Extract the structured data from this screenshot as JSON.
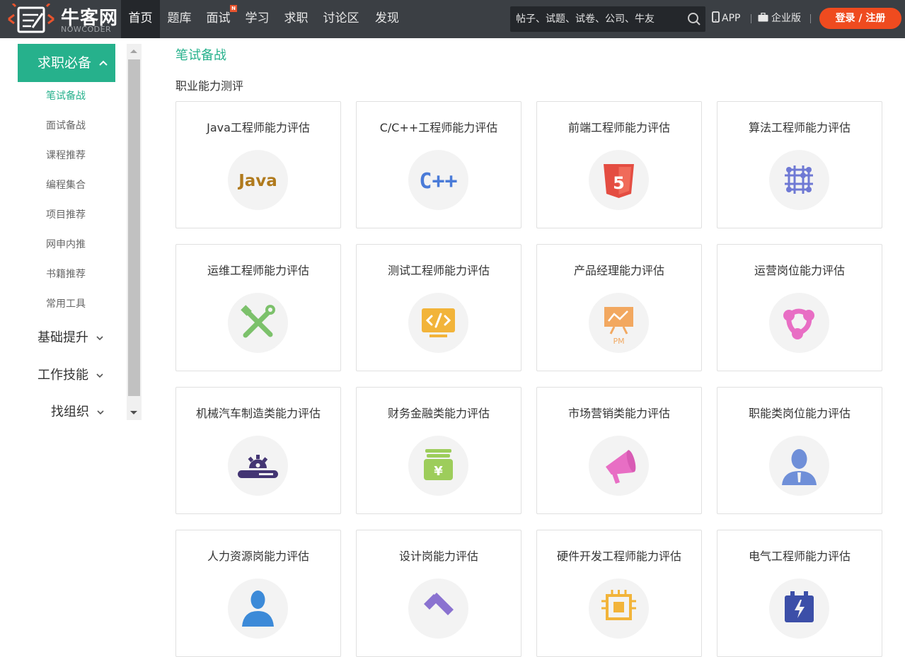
{
  "header": {
    "brand_name": "牛客网",
    "brand_sub": "NOWCODER",
    "nav": [
      {
        "label": "首页",
        "active": true
      },
      {
        "label": "题库"
      },
      {
        "label": "面试",
        "badge": "N"
      },
      {
        "label": "学习"
      },
      {
        "label": "求职"
      },
      {
        "label": "讨论区"
      },
      {
        "label": "发现"
      }
    ],
    "search_placeholder": "帖子、试题、试卷、公司、牛友",
    "app_label": "APP",
    "enterprise_label": "企业版",
    "login_label": "登录 / 注册",
    "accent": "#ef4b1f"
  },
  "sidebar": {
    "head_label": "求职必备",
    "subitems": [
      "笔试备战",
      "面试备战",
      "课程推荐",
      "编程集合",
      "项目推荐",
      "网申内推",
      "书籍推荐",
      "常用工具"
    ],
    "groups": [
      "基础提升",
      "工作技能",
      "找组织"
    ],
    "accent": "#26b18c"
  },
  "main": {
    "title": "笔试备战",
    "section": "职业能力测评",
    "cards": [
      {
        "title": "Java工程师能力评估",
        "icon": "java-icon"
      },
      {
        "title": "C/C++工程师能力评估",
        "icon": "cpp-icon"
      },
      {
        "title": "前端工程师能力评估",
        "icon": "html5-icon"
      },
      {
        "title": "算法工程师能力评估",
        "icon": "algorithm-icon"
      },
      {
        "title": "运维工程师能力评估",
        "icon": "tools-icon"
      },
      {
        "title": "测试工程师能力评估",
        "icon": "code-monitor-icon"
      },
      {
        "title": "产品经理能力评估",
        "icon": "pm-board-icon",
        "icon_text": "PM"
      },
      {
        "title": "运营岗位能力评估",
        "icon": "operation-network-icon"
      },
      {
        "title": "机械汽车制造类能力评估",
        "icon": "gear-machine-icon"
      },
      {
        "title": "财务金融类能力评估",
        "icon": "money-icon"
      },
      {
        "title": "市场营销类能力评估",
        "icon": "megaphone-icon"
      },
      {
        "title": "职能类岗位能力评估",
        "icon": "person-tie-icon"
      },
      {
        "title": "人力资源岗能力评估",
        "icon": "person-icon"
      },
      {
        "title": "设计岗能力评估",
        "icon": "pencil-icon"
      },
      {
        "title": "硬件开发工程师能力评估",
        "icon": "chip-icon"
      },
      {
        "title": "电气工程师能力评估",
        "icon": "battery-icon"
      }
    ]
  }
}
